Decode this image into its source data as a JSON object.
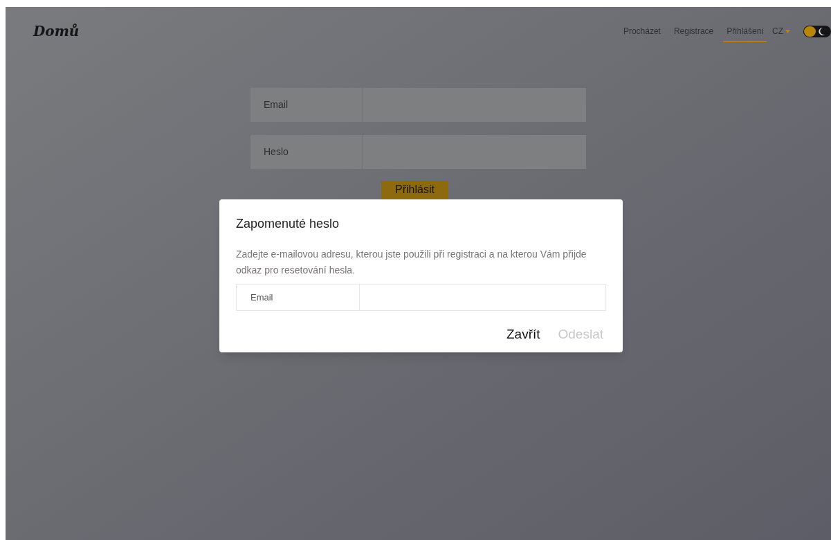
{
  "logo": "Domů",
  "nav": [
    {
      "label": "Procházet",
      "selected": false
    },
    {
      "label": "Registrace",
      "selected": false
    },
    {
      "label": "Přihlášeni",
      "selected": true
    }
  ],
  "language": "CZ",
  "theme_toggle": {
    "on": true
  },
  "login_form": {
    "fields": [
      {
        "label": "Email"
      },
      {
        "label": "Heslo"
      }
    ],
    "submit": "Přihlásit"
  },
  "dialog": {
    "title": "Zapomenuté heslo",
    "text": "Zadejte e-mailovou adresu, kterou jste použili při registraci a na kterou Vám přijde odkaz pro resetování hesla.",
    "field": {
      "label": "Email"
    },
    "buttons": [
      {
        "label": "Zavřít",
        "disabled": false
      },
      {
        "label": "Odeslat",
        "disabled": true
      }
    ]
  }
}
